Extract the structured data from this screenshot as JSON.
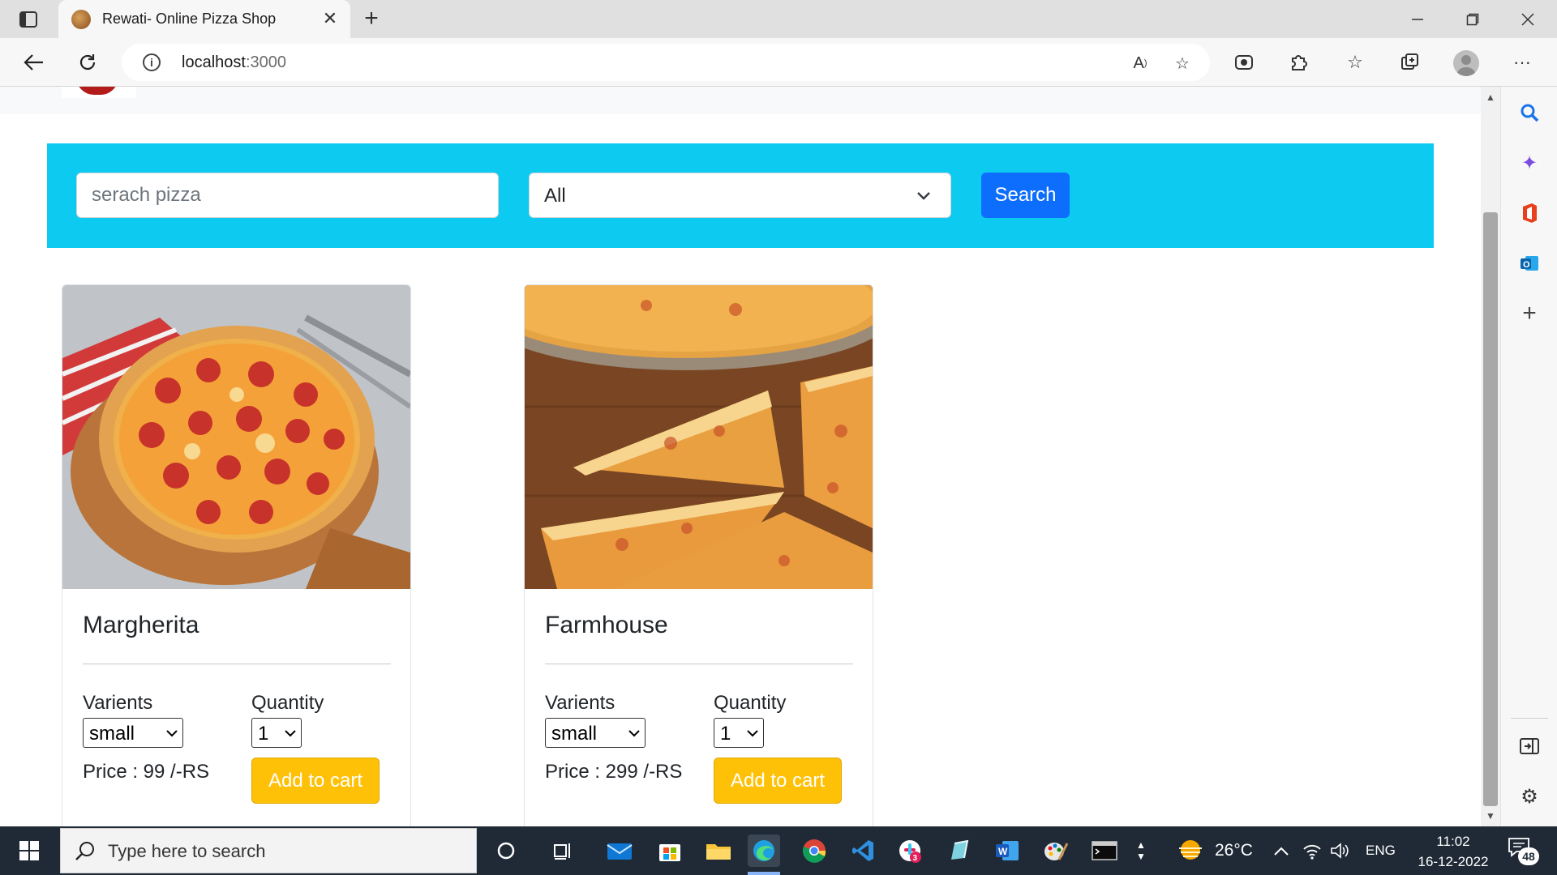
{
  "browser": {
    "tab_title": "Rewati- Online Pizza Shop",
    "url_host": "localhost",
    "url_port": ":3000"
  },
  "filters": {
    "search_placeholder": "serach pizza",
    "category_value": "All",
    "search_button": "Search"
  },
  "pizzas": [
    {
      "name": "Margherita",
      "variants_label": "Varients",
      "quantity_label": "Quantity",
      "variant_value": "small",
      "quantity_value": "1",
      "price_text": "Price : 99 /-RS",
      "cart_button": "Add to cart"
    },
    {
      "name": "Farmhouse",
      "variants_label": "Varients",
      "quantity_label": "Quantity",
      "variant_value": "small",
      "quantity_value": "1",
      "price_text": "Price : 299 /-RS",
      "cart_button": "Add to cart"
    }
  ],
  "taskbar": {
    "search_placeholder": "Type here to search",
    "weather": "26°C",
    "language": "ENG",
    "time": "11:02",
    "date": "16-12-2022",
    "notification_count": "48",
    "slack_badge": "3"
  },
  "colors": {
    "filter_bar": "#0dcaf0",
    "search_button": "#0d6efd",
    "cart_button": "#ffc107",
    "taskbar": "#1f2a36"
  }
}
